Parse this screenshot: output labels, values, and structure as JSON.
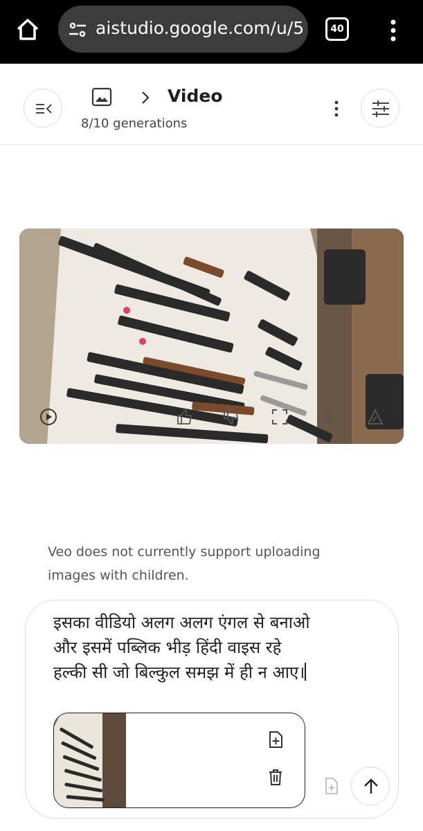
{
  "browser": {
    "url": "aistudio.google.com/u/5",
    "tab_count": "40",
    "icons": [
      "home-icon",
      "site-settings-icon",
      "tabs-icon",
      "more-vert-icon"
    ]
  },
  "header": {
    "title": "Video",
    "generations_used": "8",
    "generations_total": "/10 generations",
    "icons": [
      "sidebar-toggle-icon",
      "image-icon",
      "chevron-right-icon",
      "more-vert-icon",
      "tune-icon"
    ]
  },
  "media": {
    "icons": [
      "play-icon",
      "thumb-up-icon",
      "thumb-down-icon",
      "fullscreen-icon",
      "download-icon",
      "edit-icon"
    ]
  },
  "notice": {
    "text": "Veo does not currently support uploading images with children."
  },
  "composer": {
    "prompt": "इसका वीडियो अलग अलग एंगल से बनाओ और इसमें पब्लिक भीड़ हिंदी वाइस रहे हल्की सी जो बिल्कुल समझ में ही न आए।",
    "icons": [
      "add-doc-icon",
      "delete-icon",
      "attach-doc-icon",
      "arrow-up-icon"
    ]
  },
  "colors": {
    "browser_bar": "#000000",
    "url_pill": "#3c3c3c",
    "border": "#dcdcdc",
    "text": "#1f1f1f",
    "muted_text": "#555555"
  }
}
